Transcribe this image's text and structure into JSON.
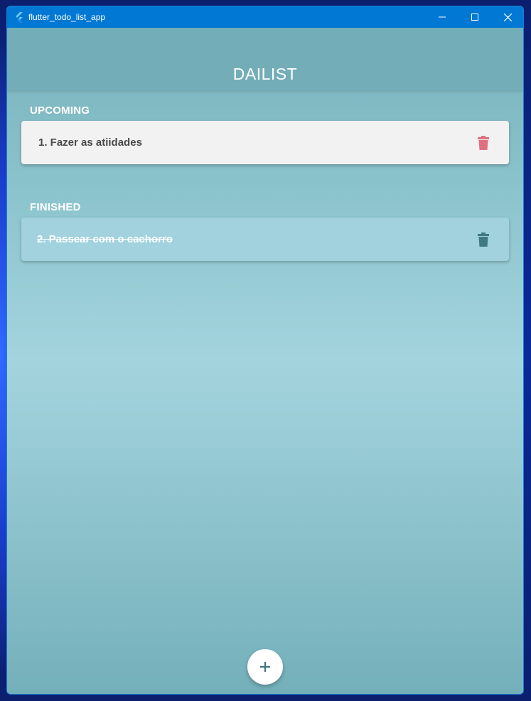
{
  "window": {
    "title": "flutter_todo_list_app"
  },
  "app": {
    "title": "DAILIST"
  },
  "sections": {
    "upcoming": {
      "label": "UPCOMING",
      "items": [
        {
          "text": "1. Fazer as atiidades",
          "icon": "trash-icon"
        }
      ]
    },
    "finished": {
      "label": "FINISHED",
      "items": [
        {
          "text": "2. Passear com o cachorro",
          "icon": "trash-icon"
        }
      ]
    }
  },
  "fab": {
    "icon": "plus-icon"
  },
  "colors": {
    "titlebar": "#0078d4",
    "appbar": "#73adb8",
    "upcoming_card": "#f2f2f2",
    "finished_card": "#a1d2dd",
    "delete_upcoming": "#e07080",
    "delete_finished": "#3f7a80",
    "fab_icon": "#3a7480"
  }
}
